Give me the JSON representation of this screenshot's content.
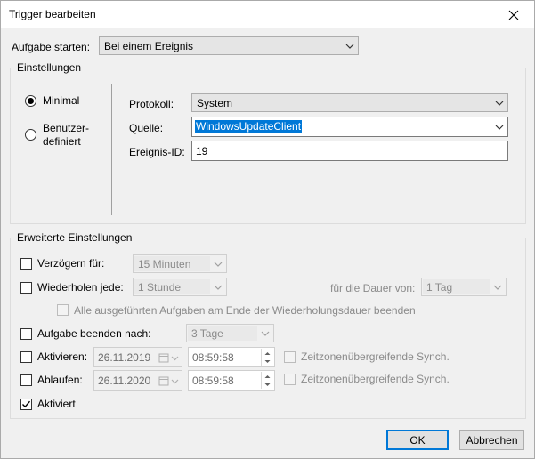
{
  "window": {
    "title": "Trigger bearbeiten"
  },
  "start": {
    "label": "Aufgabe starten:",
    "value": "Bei einem Ereignis"
  },
  "settings": {
    "group_label": "Einstellungen",
    "radio_minimal": "Minimal",
    "radio_custom_line1": "Benutzer-",
    "radio_custom_line2": "definiert",
    "protocol_label": "Protokoll:",
    "protocol_value": "System",
    "source_label": "Quelle:",
    "source_value": "WindowsUpdateClient",
    "event_id_label": "Ereignis-ID:",
    "event_id_value": "19"
  },
  "advanced": {
    "group_label": "Erweiterte Einstellungen",
    "delay_label": "Verzögern für:",
    "delay_value": "15 Minuten",
    "repeat_label": "Wiederholen jede:",
    "repeat_value": "1 Stunde",
    "duration_label": "für die Dauer von:",
    "duration_value": "1 Tag",
    "stop_all_label": "Alle ausgeführten Aufgaben am Ende der Wiederholungsdauer beenden",
    "stop_after_label": "Aufgabe beenden nach:",
    "stop_after_value": "3 Tage",
    "activate_label": "Aktivieren:",
    "activate_date": "26.11.2019",
    "activate_time": "08:59:58",
    "activate_sync_label": "Zeitzonenübergreifende Synch.",
    "expire_label": "Ablaufen:",
    "expire_date": "26.11.2020",
    "expire_time": "08:59:58",
    "expire_sync_label": "Zeitzonenübergreifende Synch.",
    "enabled_label": "Aktiviert"
  },
  "buttons": {
    "ok": "OK",
    "cancel": "Abbrechen"
  },
  "icons": {
    "close": "close-icon",
    "dropdown": "chevron-down-icon",
    "calendar": "calendar-icon",
    "spin": "spin-arrows-icon",
    "check": "checkmark-icon"
  },
  "colors": {
    "accent": "#0078d7",
    "window_bg": "#f0f0f0",
    "title_bg": "#ffffff"
  },
  "state": {
    "radio_selected": "Minimal",
    "delay_checked": false,
    "repeat_checked": false,
    "stop_all_checked": false,
    "stop_after_checked": false,
    "activate_checked": false,
    "expire_checked": false,
    "enabled_checked": true
  }
}
